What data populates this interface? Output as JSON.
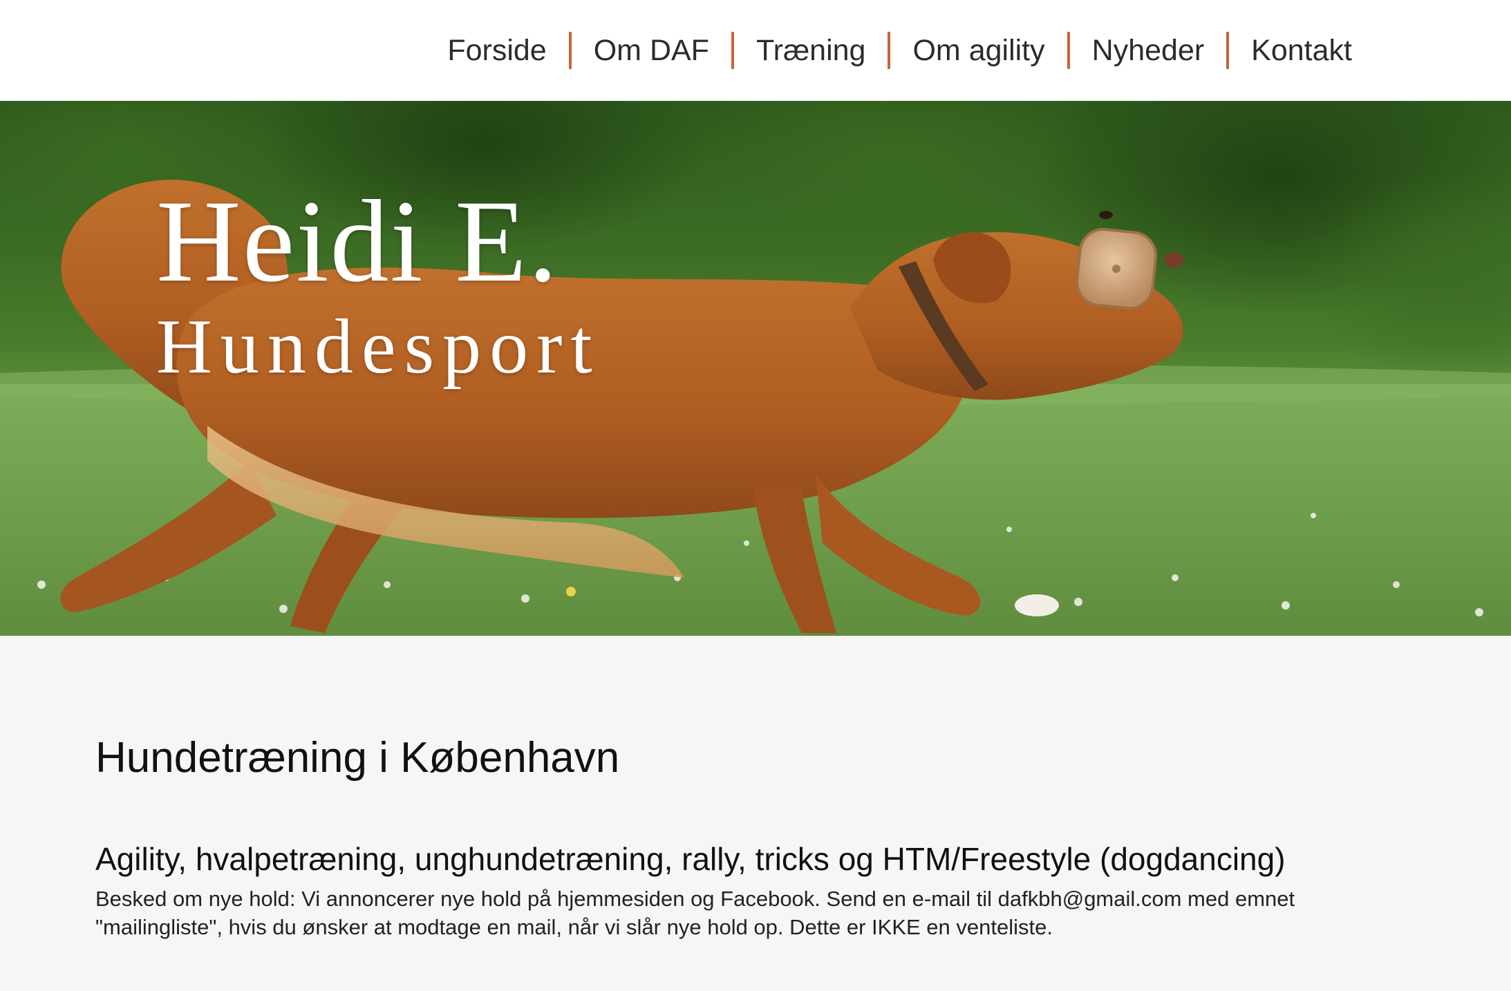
{
  "nav": {
    "items": [
      {
        "label": "Forside"
      },
      {
        "label": "Om DAF"
      },
      {
        "label": "Træning"
      },
      {
        "label": "Om agility"
      },
      {
        "label": "Nyheder"
      },
      {
        "label": "Kontakt"
      }
    ],
    "separator_color": "#c8643a",
    "text_color": "#2b2b2b"
  },
  "hero": {
    "title_line1": "Heidi E.",
    "title_line2": "Hundesport",
    "image_subject": "dog-running-with-toy-photo"
  },
  "main": {
    "heading": "Hundetræning i København",
    "subheading": "Agility, hvalpetræning, unghundetræning, rally, tricks og HTM/Freestyle (dogdancing)",
    "paragraph": "Besked om nye hold: Vi annoncerer nye hold på hjemmesiden og Facebook. Send en e-mail til dafkbh@gmail.com med emnet \"mailingliste\", hvis du ønsker at modtage en mail, når vi slår nye hold op. Dette er IKKE en venteliste."
  },
  "colors": {
    "accent": "#c8643a",
    "header_bg": "#ffffff",
    "content_bg": "#f6f6f6"
  }
}
